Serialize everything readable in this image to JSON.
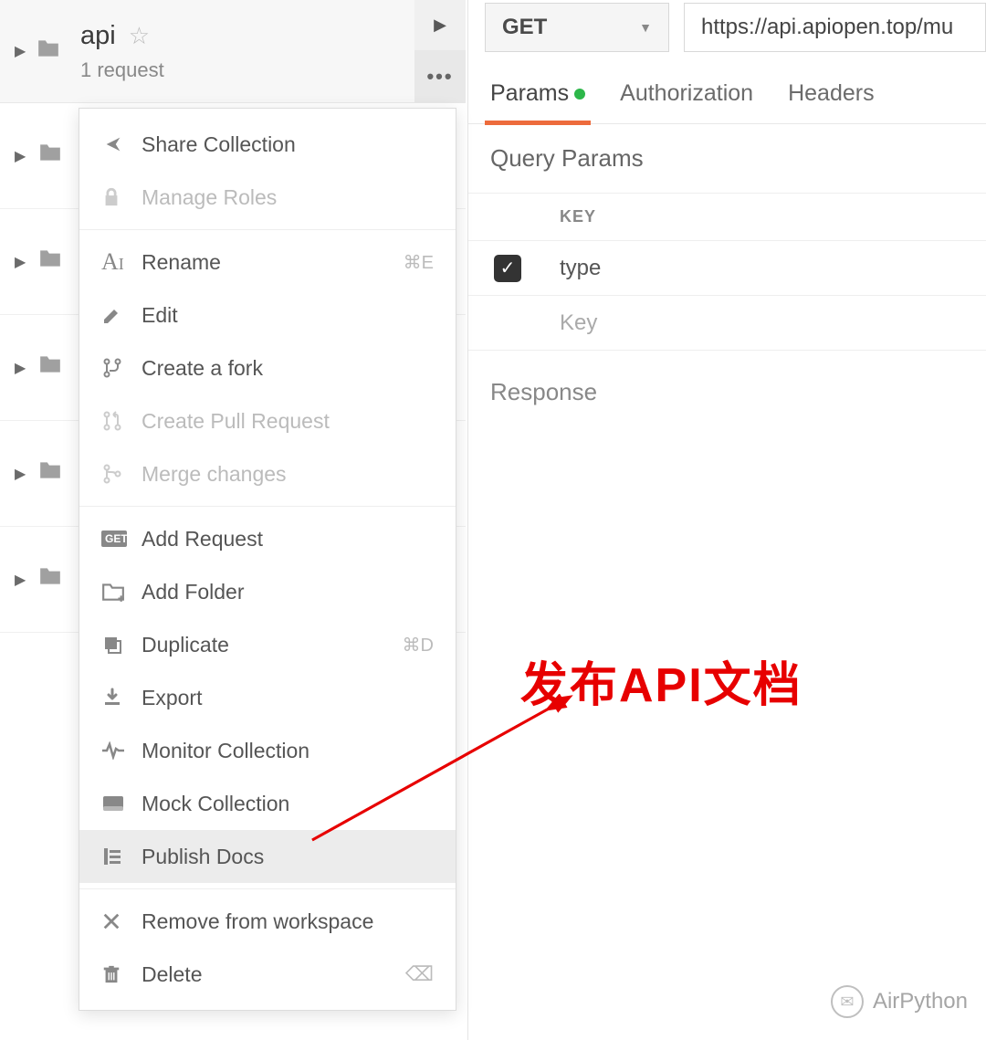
{
  "collection": {
    "name": "api",
    "subtitle": "1 request"
  },
  "context_menu": [
    {
      "icon": "share",
      "label": "Share Collection",
      "shortcut": "",
      "disabled": false,
      "hover": false
    },
    {
      "icon": "lock",
      "label": "Manage Roles",
      "shortcut": "",
      "disabled": true,
      "hover": false
    },
    {
      "icon": "rename",
      "label": "Rename",
      "shortcut": "⌘E",
      "disabled": false,
      "hover": false
    },
    {
      "icon": "edit",
      "label": "Edit",
      "shortcut": "",
      "disabled": false,
      "hover": false
    },
    {
      "icon": "fork",
      "label": "Create a fork",
      "shortcut": "",
      "disabled": false,
      "hover": false
    },
    {
      "icon": "pr",
      "label": "Create Pull Request",
      "shortcut": "",
      "disabled": true,
      "hover": false
    },
    {
      "icon": "merge",
      "label": "Merge changes",
      "shortcut": "",
      "disabled": true,
      "hover": false
    },
    {
      "icon": "get",
      "label": "Add Request",
      "shortcut": "",
      "disabled": false,
      "hover": false
    },
    {
      "icon": "addfold",
      "label": "Add Folder",
      "shortcut": "",
      "disabled": false,
      "hover": false
    },
    {
      "icon": "dup",
      "label": "Duplicate",
      "shortcut": "⌘D",
      "disabled": false,
      "hover": false
    },
    {
      "icon": "export",
      "label": "Export",
      "shortcut": "",
      "disabled": false,
      "hover": false
    },
    {
      "icon": "monitor",
      "label": "Monitor Collection",
      "shortcut": "",
      "disabled": false,
      "hover": false
    },
    {
      "icon": "mock",
      "label": "Mock Collection",
      "shortcut": "",
      "disabled": false,
      "hover": false
    },
    {
      "icon": "publish",
      "label": "Publish Docs",
      "shortcut": "",
      "disabled": false,
      "hover": true
    },
    {
      "icon": "remove",
      "label": "Remove from workspace",
      "shortcut": "",
      "disabled": false,
      "hover": false
    },
    {
      "icon": "delete",
      "label": "Delete",
      "shortcut": "⌫",
      "disabled": false,
      "hover": false
    }
  ],
  "request": {
    "method": "GET",
    "url": "https://api.apiopen.top/mu"
  },
  "tabs": {
    "params": "Params",
    "authorization": "Authorization",
    "headers": "Headers"
  },
  "query_params": {
    "title": "Query Params",
    "header_key": "KEY",
    "rows": [
      {
        "checked": true,
        "key": "type"
      }
    ],
    "placeholder_key": "Key"
  },
  "response_label": "Response",
  "annotation_text": "发布API文档",
  "watermark": "AirPython",
  "icons": {
    "get_badge": "GET"
  }
}
